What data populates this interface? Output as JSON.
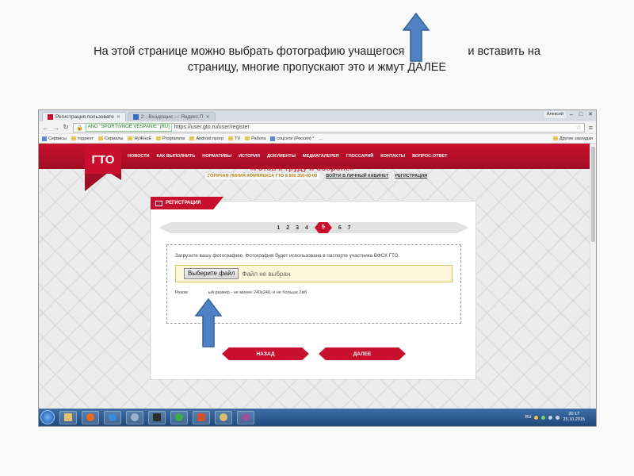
{
  "caption": {
    "line1_a": "На этой странице можно выбрать фотографию учащегося",
    "line1_b": "и вставить на",
    "line2": "страницу, многие пропускают это и жмут ДАЛЕЕ"
  },
  "browser": {
    "tabs": [
      {
        "label": "Регистрация пользовате",
        "icon": "gto-favicon"
      },
      {
        "label": "2 - Входящие — Яндекс.П",
        "icon": "mail-favicon"
      }
    ],
    "user_label": "Алексей",
    "ev_badge": "ANO \"SPORTIVNOE VESPANIE\" [RU]",
    "url": "https://user.gto.ru/user/register",
    "bookmarks": [
      "Сервисы",
      "торрент",
      "Сериалы",
      "НуЖноЕ",
      "Programms",
      "Android прогр",
      "TV",
      "Работа",
      "соцсети (Россия) *",
      "..."
    ],
    "other_bookmarks": "Другие закладки"
  },
  "site": {
    "logo": "ГТО",
    "nav": [
      "НОВОСТИ",
      "КАК ВЫПОЛНИТЬ",
      "НОРМАТИВЫ",
      "ИСТОРИЯ",
      "ДОКУМЕНТЫ",
      "МЕДИАГАЛЕРЕЯ",
      "ГЛОССАРИЙ",
      "КОНТАКТЫ",
      "ВОПРОС-ОТВЕТ"
    ],
    "slogan": "«Готов к труду и обороне»",
    "hotline": "ГОРЯЧАЯ ЛИНИЯ КОМПЛЕКСА ГТО 8 800 350-00-00",
    "login_link": "ВОЙТИ В ЛИЧНЫЙ КАБИНЕТ",
    "register_link": "РЕГИСТРАЦИЯ"
  },
  "registration": {
    "header": "РЕГИСТРАЦИЯ",
    "steps": [
      "1",
      "2",
      "3",
      "4",
      "5",
      "6",
      "7"
    ],
    "active_step": "5",
    "upload_text": "Загрузите вашу фотографию. Фотография будет использована в паспорте участника ВФСК ГТО.",
    "file_button": "Выберите файл",
    "file_status": "Файл не выбран",
    "hint_a": "Реком",
    "hint_b": "ый размер - не менее 240х240, и не больше 2мб",
    "back_button": "НАЗАД",
    "next_button": "ДАЛЕЕ"
  },
  "taskbar": {
    "lang": "RU",
    "time": "20:17",
    "date": "25.10.2015"
  },
  "colors": {
    "brand_red": "#c8102e",
    "arrow_blue": "#4f82c4",
    "arrow_outline": "#35619b"
  }
}
